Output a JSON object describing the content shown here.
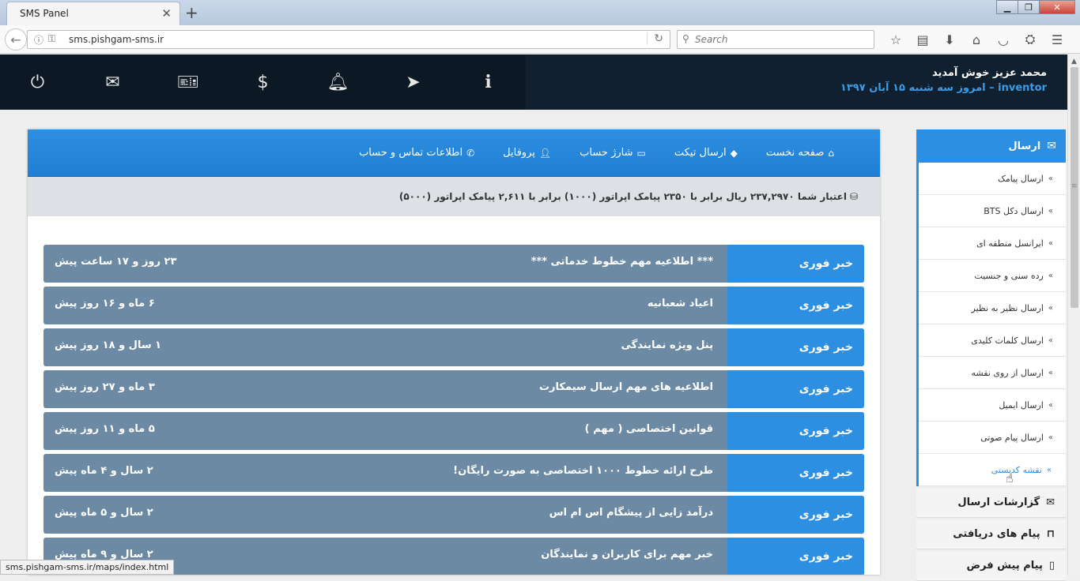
{
  "browser": {
    "tab_title": "SMS Panel",
    "tab_close": "✕",
    "new_tab": "+",
    "url": "sms.pishgam-sms.ir",
    "search_placeholder": "Search",
    "status_url": "sms.pishgam-sms.ir/maps/index.html"
  },
  "header": {
    "welcome_name": "محمد عزیز خوش آمدید",
    "username": "inventor",
    "date_text": "– امروز سه شنبه ۱۵ آبان ۱۳۹۷",
    "icons": [
      "power-icon",
      "envelope-icon",
      "ticket-icon",
      "dollar-icon",
      "bell-icon",
      "paper-plane-icon",
      "info-icon"
    ]
  },
  "nav": {
    "items": [
      {
        "label": "صفحه نخست",
        "icon": "home-icon"
      },
      {
        "label": "ارسال تیکت",
        "icon": "ticket-icon"
      },
      {
        "label": "شارژ حساب",
        "icon": "credit-card-icon"
      },
      {
        "label": "پروفایل",
        "icon": "user-icon"
      },
      {
        "label": "اطلاعات تماس و حساب",
        "icon": "phone-icon"
      }
    ]
  },
  "credit": {
    "text": "اعتبار شما ۲۳۷,۲۹۷۰ ریال برابر با ۲۳۵۰ پیامک اپراتور (۱۰۰۰) برابر با ۲,۶۱۱ پیامک اپراتور (۵۰۰۰)"
  },
  "news": {
    "badge_label": "خبر فوری",
    "items": [
      {
        "title": "*** اطلاعیه مهم خطوط خدماتی ***",
        "time": "۲۳ روز و ۱۷ ساعت پیش"
      },
      {
        "title": "اعیاد شعبانیه",
        "time": "۶ ماه و ۱۶ روز پیش"
      },
      {
        "title": "پنل ویژه نمایندگی",
        "time": "۱ سال و ۱۸ روز پیش"
      },
      {
        "title": "اطلاعیه های مهم ارسال سیمکارت",
        "time": "۳ ماه و ۲۷ روز پیش"
      },
      {
        "title": "قوانین اختصاصی ( مهم )",
        "time": "۵ ماه و ۱۱ روز پیش"
      },
      {
        "title": "طرح ارائه خطوط ۱۰۰۰ اختصاصی به صورت رایگان!",
        "time": "۲ سال و ۴ ماه پیش"
      },
      {
        "title": "درآمد زایی از پیشگام اس ام اس",
        "time": "۲ سال و ۵ ماه پیش"
      },
      {
        "title": "خبر مهم برای کاربران و نمایندگان",
        "time": "۲ سال و ۹ ماه پیش"
      }
    ]
  },
  "sidebar": {
    "header_label": "ارسال",
    "items": [
      "ارسال پیامک",
      "ارسال دکل BTS",
      "ایرانسل منطقه ای",
      "رده سنی و جنسیت",
      "ارسال نظیر به نظیر",
      "ارسال کلمات کلیدی",
      "ارسال از روی نقشه",
      "ارسال ایمیل",
      "ارسال پیام صوتی",
      "نقشه کدپستی"
    ],
    "sections": [
      {
        "label": "گزارشات ارسال",
        "icon": "envelope-icon"
      },
      {
        "label": "پیام های دریافتی",
        "icon": "inbox-icon"
      },
      {
        "label": "پیام پیش فرض",
        "icon": "mobile-icon"
      }
    ]
  },
  "colors": {
    "accent": "#2c8fe1",
    "header_bg": "#10202e",
    "news_row": "#6c8aa3"
  }
}
